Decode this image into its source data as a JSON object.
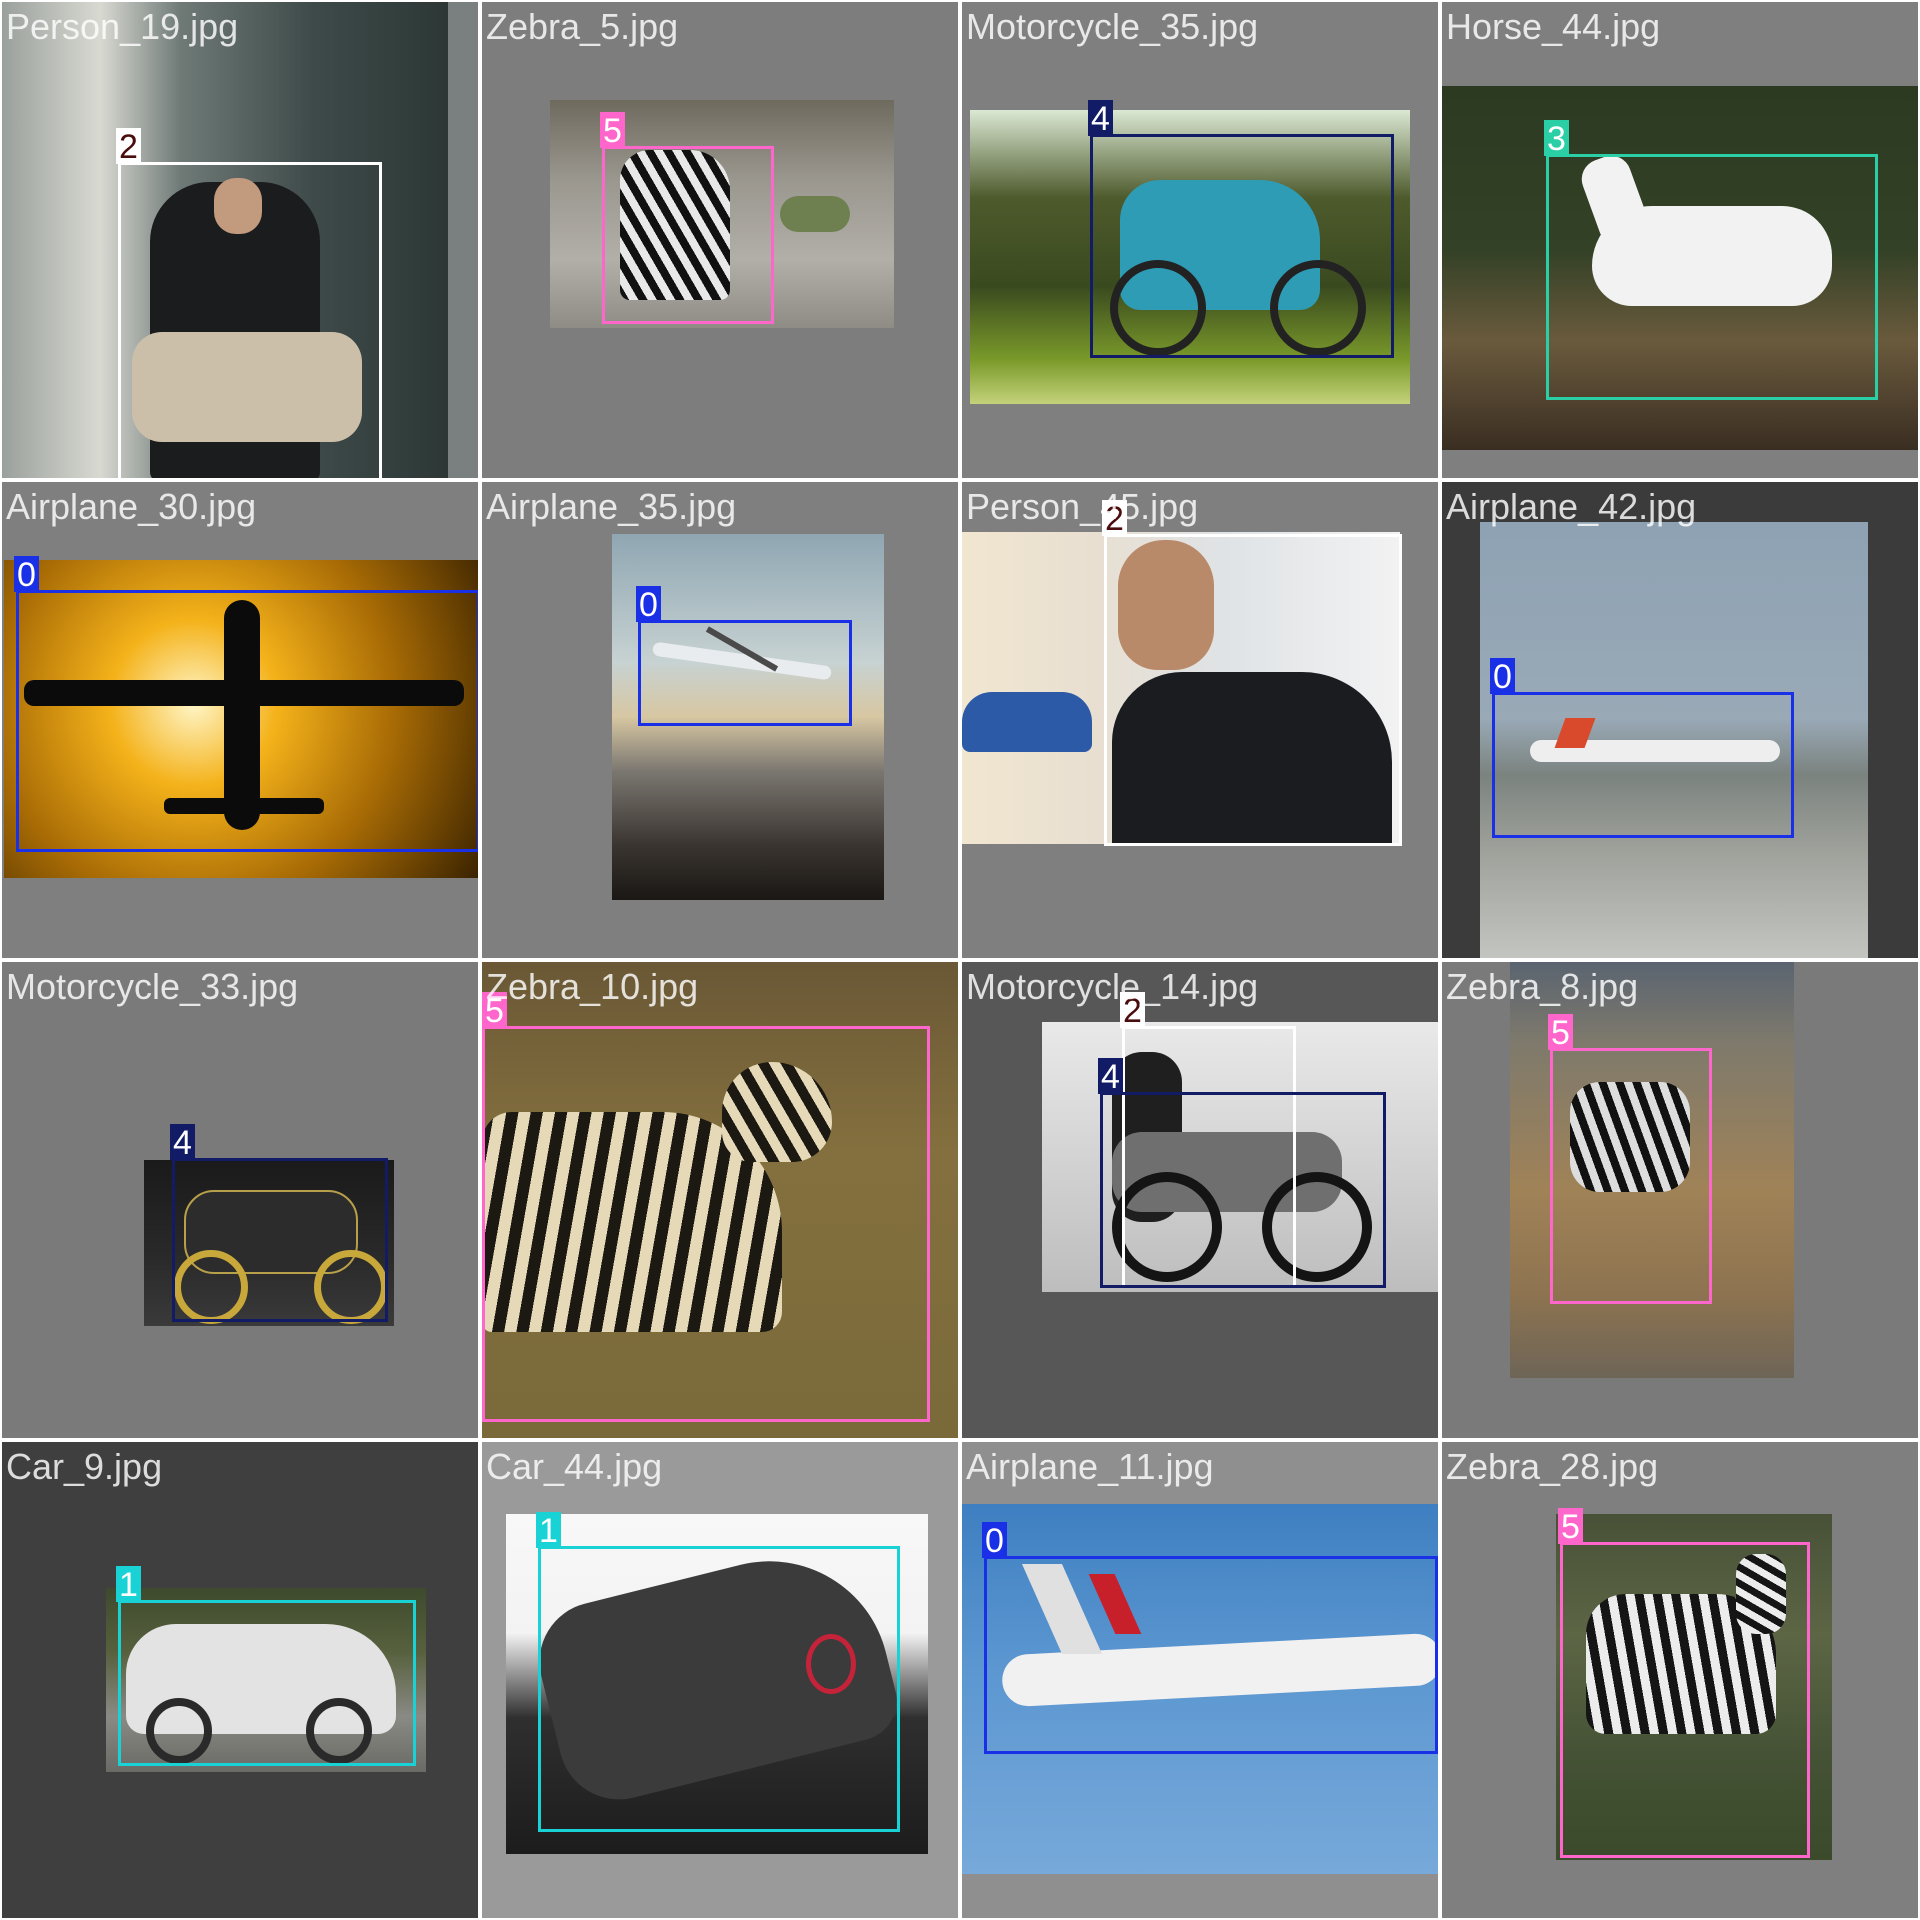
{
  "colors": {
    "0": "#1a30e6",
    "1": "#18d2d6",
    "2": "#ffffff",
    "3": "#2bcfa5",
    "4": "#121c66",
    "5": "#ff66cc"
  },
  "tiles": [
    {
      "filename": "Person_19.jpg",
      "classes": [
        "2"
      ],
      "subject": "man-sitting-on-steps-icon"
    },
    {
      "filename": "Zebra_5.jpg",
      "classes": [
        "5"
      ],
      "subject": "grazing-zebra-icon"
    },
    {
      "filename": "Motorcycle_35.jpg",
      "classes": [
        "4"
      ],
      "subject": "teal-motorcycle-icon"
    },
    {
      "filename": "Horse_44.jpg",
      "classes": [
        "3"
      ],
      "subject": "white-horse-icon"
    },
    {
      "filename": "Airplane_30.jpg",
      "classes": [
        "0"
      ],
      "subject": "airplane-silhouette-sunset-icon"
    },
    {
      "filename": "Airplane_35.jpg",
      "classes": [
        "0"
      ],
      "subject": "jet-over-mountains-icon"
    },
    {
      "filename": "Person_45.jpg",
      "classes": [
        "2"
      ],
      "subject": "smiling-man-sunglasses-icon"
    },
    {
      "filename": "Airplane_42.jpg",
      "classes": [
        "0"
      ],
      "subject": "plane-on-runway-icon"
    },
    {
      "filename": "Motorcycle_33.jpg",
      "classes": [
        "4"
      ],
      "subject": "cafe-racer-motorcycle-icon"
    },
    {
      "filename": "Zebra_10.jpg",
      "classes": [
        "5"
      ],
      "subject": "zebra-in-grass-icon"
    },
    {
      "filename": "Motorcycle_14.jpg",
      "classes": [
        "2",
        "4"
      ],
      "subject": "man-with-motorcycle-icon"
    },
    {
      "filename": "Zebra_8.jpg",
      "classes": [
        "5"
      ],
      "subject": "standing-zebra-icon"
    },
    {
      "filename": "Car_9.jpg",
      "classes": [
        "1"
      ],
      "subject": "white-suv-icon"
    },
    {
      "filename": "Car_44.jpg",
      "classes": [
        "1"
      ],
      "subject": "black-sports-car-icon"
    },
    {
      "filename": "Airplane_11.jpg",
      "classes": [
        "0"
      ],
      "subject": "virgin-airliner-icon"
    },
    {
      "filename": "Zebra_28.jpg",
      "classes": [
        "5"
      ],
      "subject": "zebra-in-bushes-icon"
    }
  ]
}
